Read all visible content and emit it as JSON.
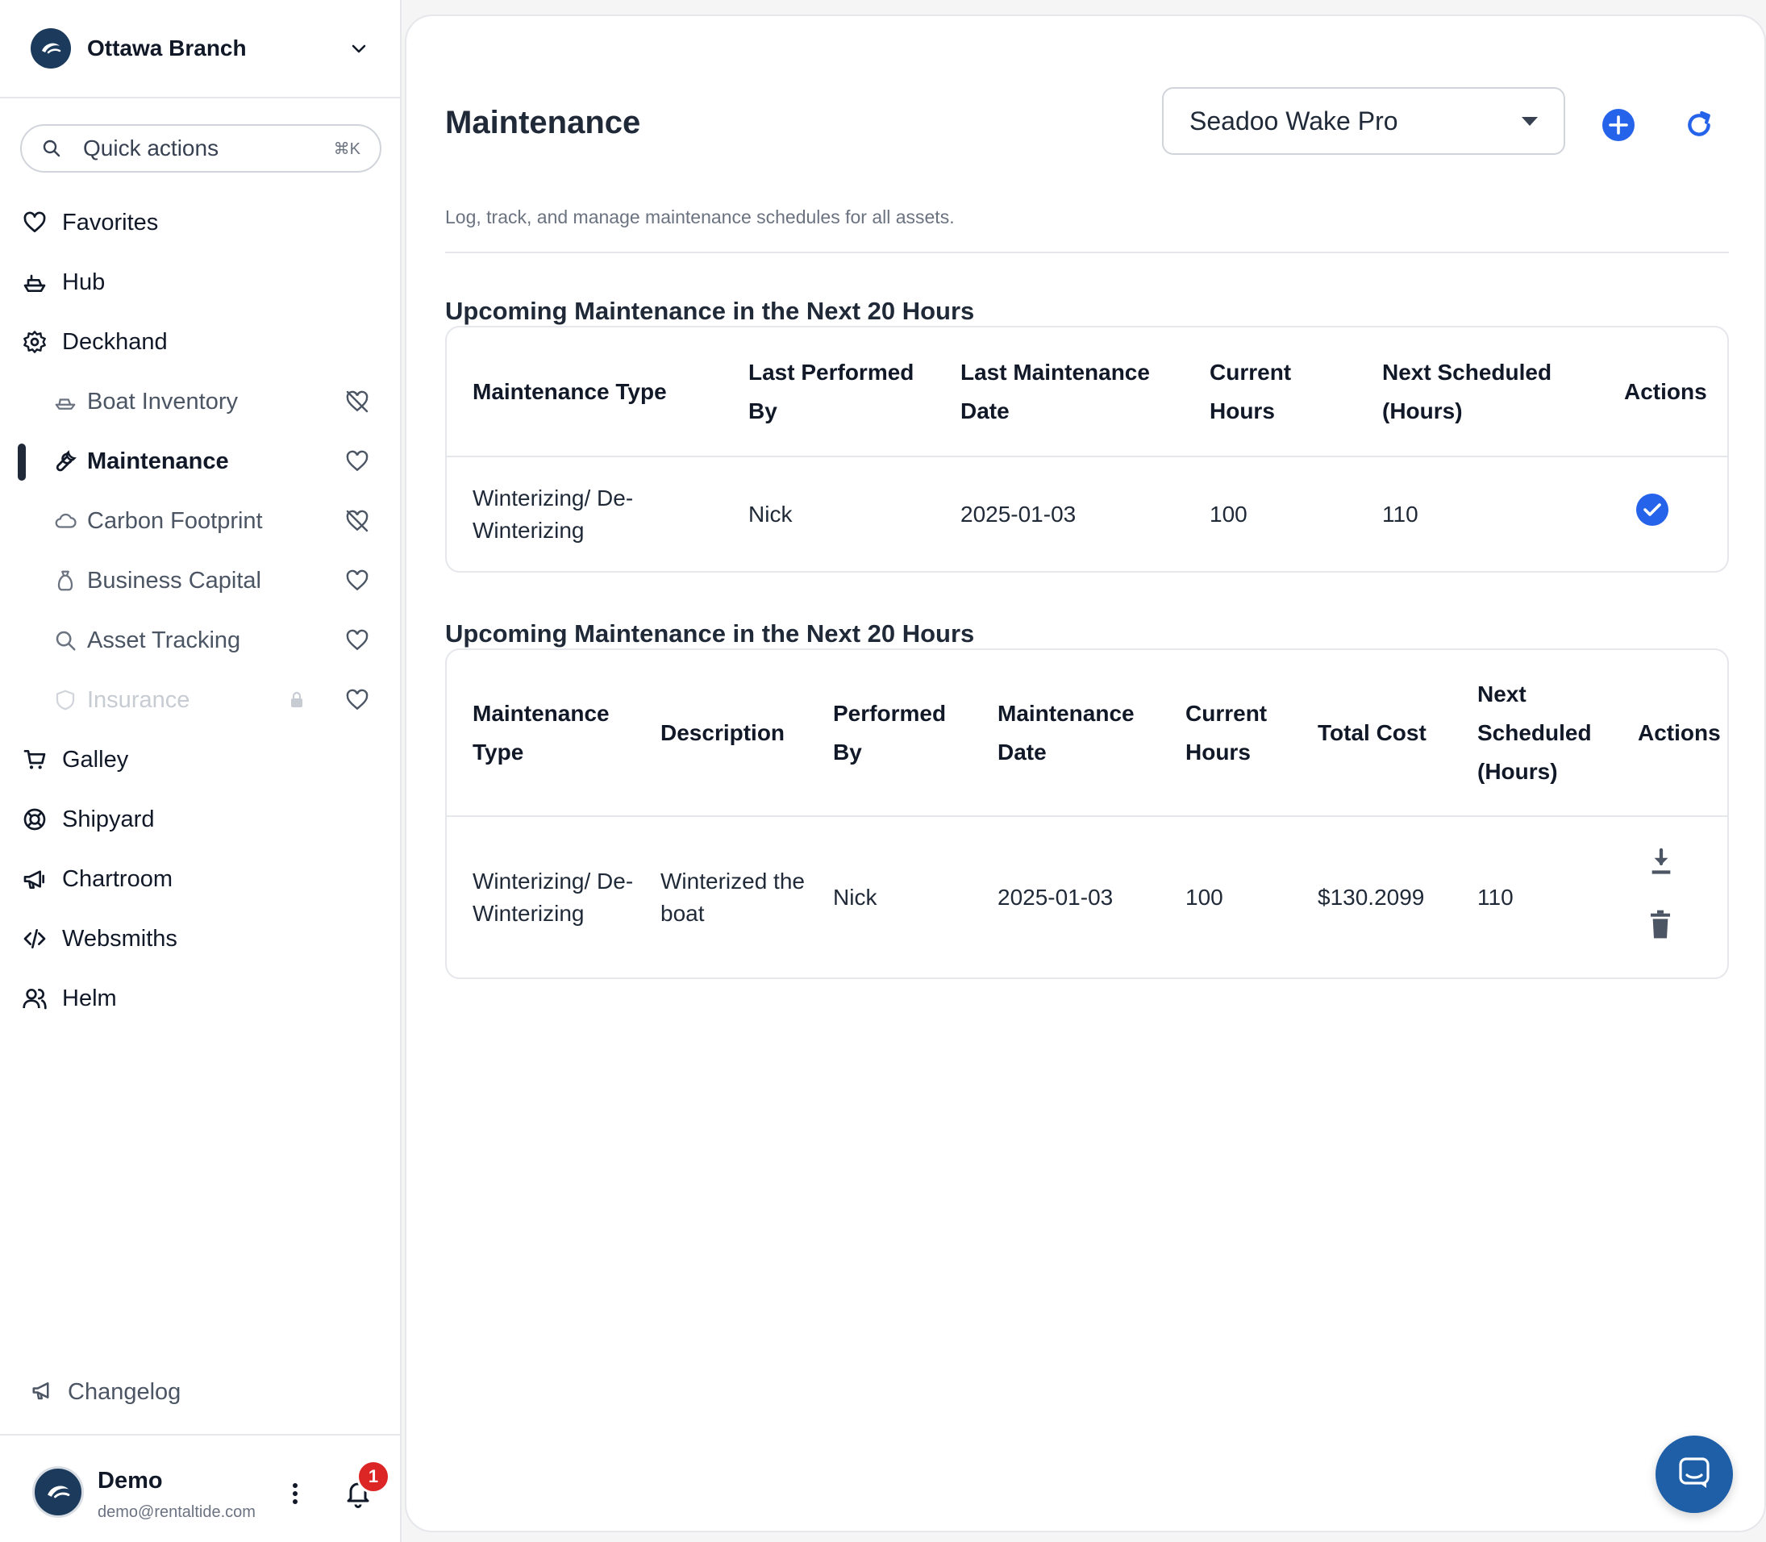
{
  "branch": {
    "name": "Ottawa Branch"
  },
  "quick_actions": {
    "label": "Quick actions",
    "shortcut": "⌘K"
  },
  "nav": {
    "favorites": "Favorites",
    "hub": "Hub",
    "deckhand": "Deckhand",
    "boat_inventory": "Boat Inventory",
    "maintenance": "Maintenance",
    "carbon_footprint": "Carbon Footprint",
    "business_capital": "Business Capital",
    "asset_tracking": "Asset Tracking",
    "insurance": "Insurance",
    "galley": "Galley",
    "shipyard": "Shipyard",
    "chartroom": "Chartroom",
    "websmiths": "Websmiths",
    "helm": "Helm",
    "changelog": "Changelog"
  },
  "user": {
    "name": "Demo",
    "email": "demo@rentaltide.com",
    "notifications": "1"
  },
  "page": {
    "title": "Maintenance",
    "subtitle": "Log, track, and manage maintenance schedules for all assets.",
    "selected_asset": "Seadoo Wake Pro"
  },
  "upcoming": {
    "title": "Upcoming Maintenance in the Next 20 Hours",
    "headers": {
      "type": "Maintenance Type",
      "performed_by": "Last Performed By",
      "date": "Last Maintenance Date",
      "hours": "Current Hours",
      "next": "Next Scheduled (Hours)",
      "actions": "Actions"
    },
    "rows": [
      {
        "type": "Winterizing/ De-Winterizing",
        "performed_by": "Nick",
        "date": "2025-01-03",
        "hours": "100",
        "next": "110"
      }
    ]
  },
  "history": {
    "title": "Upcoming Maintenance in the Next 20 Hours",
    "headers": {
      "type": "Maintenance Type",
      "description": "Description",
      "performed_by": "Performed By",
      "date": "Maintenance Date",
      "hours": "Current Hours",
      "cost": "Total Cost",
      "next": "Next Scheduled (Hours)",
      "actions": "Actions"
    },
    "rows": [
      {
        "type": "Winterizing/ De-Winterizing",
        "description": "Winterized the boat",
        "performed_by": "Nick",
        "date": "2025-01-03",
        "hours": "100",
        "cost": "$130.2099",
        "next": "110"
      }
    ]
  },
  "colors": {
    "accent": "#2563eb",
    "brand_navy": "#1b3a5c",
    "badge": "#dc2626",
    "chat": "#1f5fa8"
  }
}
